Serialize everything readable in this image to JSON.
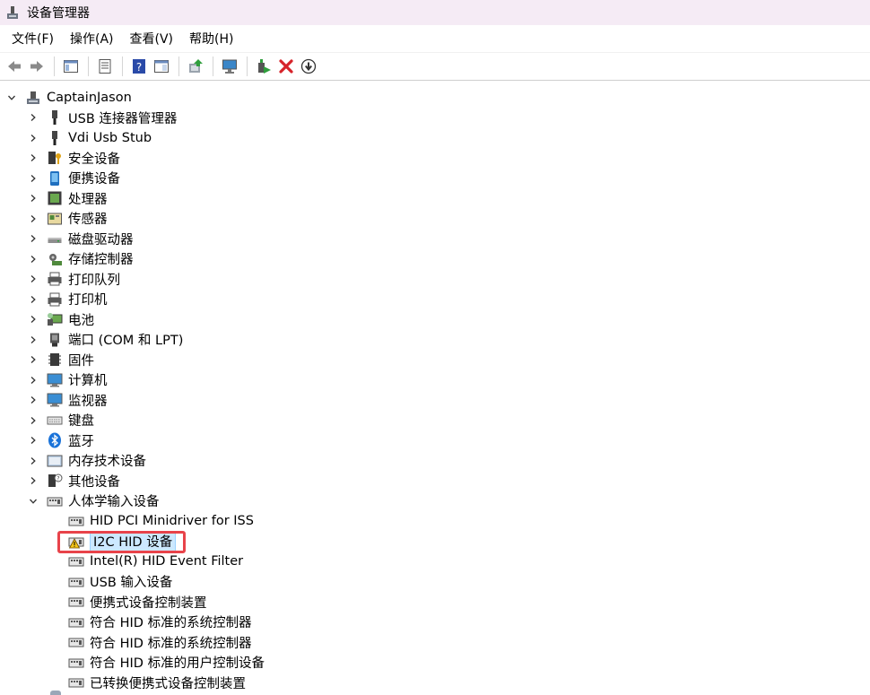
{
  "window": {
    "title": "设备管理器"
  },
  "menu": [
    {
      "label": "文件(F)",
      "name": "menu-file"
    },
    {
      "label": "操作(A)",
      "name": "menu-action"
    },
    {
      "label": "查看(V)",
      "name": "menu-view"
    },
    {
      "label": "帮助(H)",
      "name": "menu-help"
    }
  ],
  "toolbar": [
    "back-icon",
    "forward-icon",
    "show-hide-console-tree-icon",
    "properties-icon",
    "help-icon",
    "action-pane-icon",
    "update-driver-icon",
    "scan-hardware-icon",
    "enable-device-icon",
    "uninstall-device-icon",
    "disable-device-icon"
  ],
  "tree": {
    "root": "CaptainJason",
    "categories": [
      {
        "label": "USB 连接器管理器",
        "icon": "usb-icon"
      },
      {
        "label": "Vdi Usb Stub",
        "icon": "usb-icon"
      },
      {
        "label": "安全设备",
        "icon": "security-device-icon"
      },
      {
        "label": "便携设备",
        "icon": "portable-device-icon"
      },
      {
        "label": "处理器",
        "icon": "processor-icon"
      },
      {
        "label": "传感器",
        "icon": "sensor-icon"
      },
      {
        "label": "磁盘驱动器",
        "icon": "disk-drive-icon"
      },
      {
        "label": "存储控制器",
        "icon": "storage-controller-icon"
      },
      {
        "label": "打印队列",
        "icon": "printer-icon"
      },
      {
        "label": "打印机",
        "icon": "printer-icon"
      },
      {
        "label": "电池",
        "icon": "battery-icon"
      },
      {
        "label": "端口 (COM 和 LPT)",
        "icon": "port-icon"
      },
      {
        "label": "固件",
        "icon": "firmware-icon"
      },
      {
        "label": "计算机",
        "icon": "computer-icon"
      },
      {
        "label": "监视器",
        "icon": "monitor-icon"
      },
      {
        "label": "键盘",
        "icon": "keyboard-icon"
      },
      {
        "label": "蓝牙",
        "icon": "bluetooth-icon"
      },
      {
        "label": "内存技术设备",
        "icon": "memory-device-icon"
      },
      {
        "label": "其他设备",
        "icon": "other-device-icon"
      },
      {
        "label": "人体学输入设备",
        "icon": "hid-icon",
        "expanded": true
      }
    ],
    "hid_children": [
      {
        "label": "HID PCI Minidriver for ISS",
        "warning": false
      },
      {
        "label": "I2C HID 设备",
        "warning": true,
        "selected": true
      },
      {
        "label": "Intel(R) HID Event Filter",
        "warning": false
      },
      {
        "label": "USB 输入设备",
        "warning": false
      },
      {
        "label": "便携式设备控制装置",
        "warning": false
      },
      {
        "label": "符合 HID 标准的系统控制器",
        "warning": false
      },
      {
        "label": "符合 HID 标准的系统控制器",
        "warning": false
      },
      {
        "label": "符合 HID 标准的用户控制设备",
        "warning": false
      },
      {
        "label": "已转换便携式设备控制装置",
        "warning": false
      }
    ]
  }
}
